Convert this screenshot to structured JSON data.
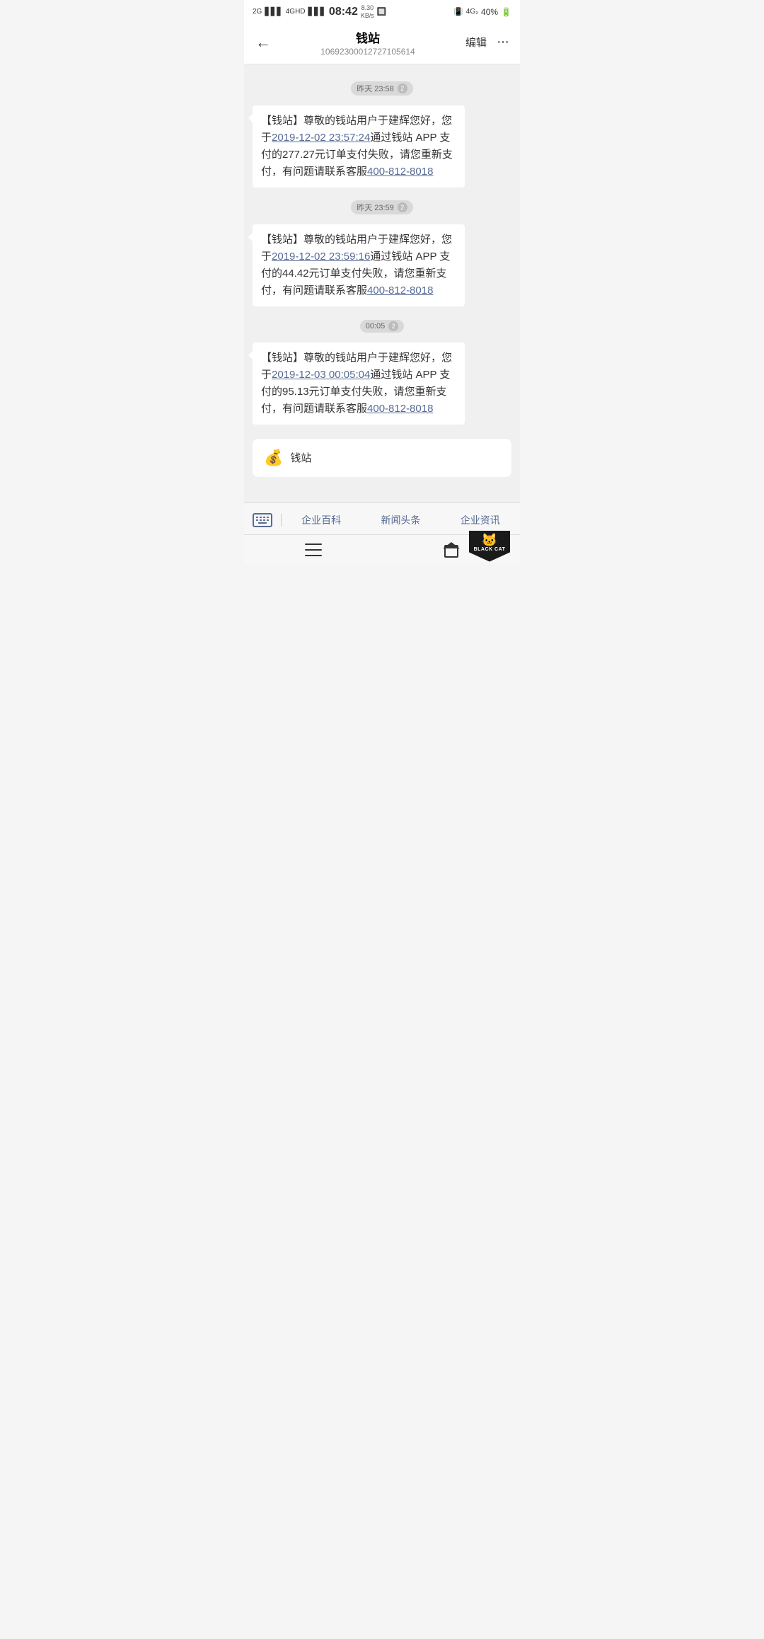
{
  "statusBar": {
    "leftSignal1": "2G",
    "leftSignal2": "4G+HD",
    "time": "08:42",
    "speed": "8.30\nKB/s",
    "rightSignal": "4G",
    "battery": "40%"
  },
  "header": {
    "backLabel": "←",
    "title": "钱站",
    "subtitle": "10692300012727105614",
    "editLabel": "编辑",
    "moreLabel": "···"
  },
  "messages": [
    {
      "timestamp": "昨天 23:58",
      "count": "2",
      "text_prefix": "【钱站】尊敬的钱站用户于建辉您好，您于",
      "link1": "2019-12-02 23:57:24",
      "text_mid": "通过钱站 APP 支付的277.27元订单支付失败，请您重新支付，有问题请联系客服",
      "phone": "400-812-8018"
    },
    {
      "timestamp": "昨天 23:59",
      "count": "2",
      "text_prefix": "【钱站】尊敬的钱站用户于建辉您好，您于",
      "link1": "2019-12-02 23:59:16",
      "text_mid": "通过钱站 APP 支付的44.42元订单支付失败，请您重新支付，有问题请联系客服",
      "phone": "400-812-8018"
    },
    {
      "timestamp": "00:05",
      "count": "2",
      "text_prefix": "【钱站】尊敬的钱站用户于建辉您好，您于",
      "link1": "2019-12-03 00:05:04",
      "text_mid": "通过钱站 APP 支付的95.13元订单支付失败，请您重新支付，有问题请联系客服",
      "phone": "400-812-8018"
    }
  ],
  "actionCard": {
    "icon": "💰",
    "label": "钱站"
  },
  "toolbar": {
    "keyboardLabel": "⌨",
    "link1": "企业百科",
    "link2": "新闻头条",
    "link3": "企业资讯"
  },
  "bottomNav": {
    "menuLabel": "≡",
    "homeLabel": "⌂"
  },
  "blackCat": {
    "catEmoji": "🐱",
    "text": "BLACK CAT"
  }
}
